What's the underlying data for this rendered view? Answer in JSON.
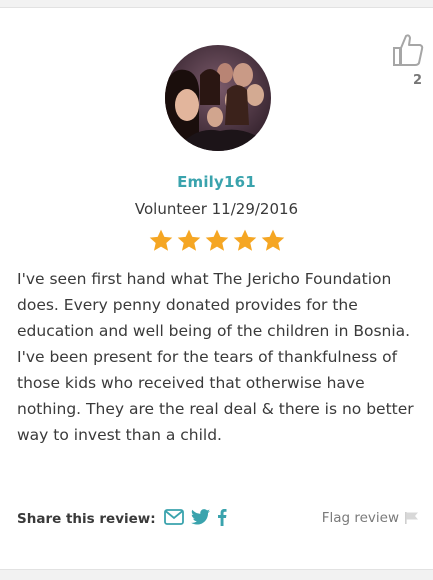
{
  "review": {
    "username": "Emily161",
    "role_date": "Volunteer 11/29/2016",
    "rating": 5,
    "max_rating": 5,
    "text": "I've seen first hand what The Jericho Foundation does. Every penny donated provides for the education and well being of the children in Bosnia. I've been present for the tears of thankfulness of those kids who received that otherwise have nothing. They are the real deal & there is no better way to invest than a child.",
    "likes": "2"
  },
  "share": {
    "label": "Share this review:",
    "icons": [
      "email-icon",
      "twitter-icon",
      "facebook-icon"
    ]
  },
  "flag": {
    "label": "Flag review",
    "icon": "flag-icon"
  },
  "colors": {
    "accent": "#3aa3ad",
    "star": "#f5a623",
    "muted": "#9a9a9a"
  }
}
